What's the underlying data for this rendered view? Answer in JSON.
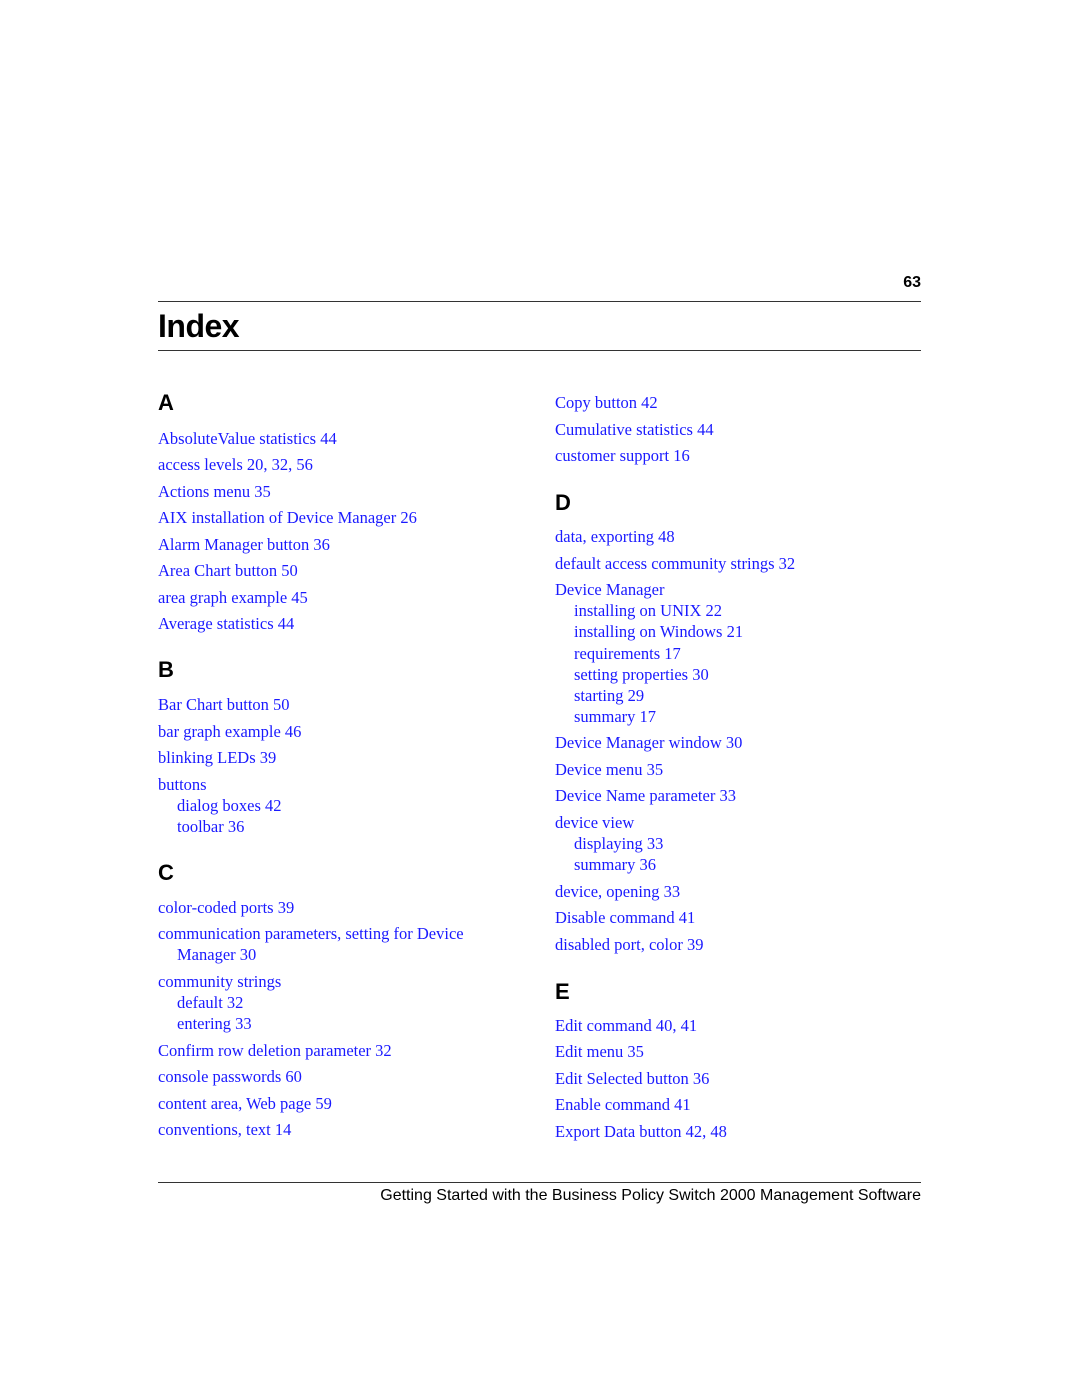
{
  "header": {
    "page_number": "63",
    "title": "Index"
  },
  "footer": {
    "text": "Getting Started with the Business Policy Switch 2000 Management Software"
  },
  "colors": {
    "link": "#1a1aff",
    "text": "#000000"
  },
  "sections": {
    "A": {
      "letter": "A",
      "entries": [
        "AbsoluteValue statistics 44",
        "access levels 20, 32, 56",
        "Actions menu 35",
        "AIX installation of Device Manager 26",
        "Alarm Manager button 36",
        "Area Chart button 50",
        "area graph example 45",
        "Average statistics 44"
      ]
    },
    "B": {
      "letter": "B",
      "entries": [
        "Bar Chart button 50",
        "bar graph example 46",
        "blinking LEDs 39",
        "buttons",
        "dialog boxes 42",
        "toolbar 36"
      ]
    },
    "C": {
      "letter": "C",
      "entries": [
        "color-coded ports 39",
        "communication parameters, setting for Device",
        "Manager 30",
        "community strings",
        "default 32",
        "entering 33",
        "Confirm row deletion parameter 32",
        "console passwords 60",
        "content area, Web page 59",
        "conventions, text 14",
        "Copy button 42",
        "Cumulative statistics 44",
        "customer support 16"
      ]
    },
    "D": {
      "letter": "D",
      "entries": [
        "data, exporting 48",
        "default access community strings 32",
        "Device Manager",
        "installing on UNIX 22",
        "installing on Windows 21",
        "requirements 17",
        "setting properties 30",
        "starting 29",
        "summary 17",
        "Device Manager window 30",
        "Device menu 35",
        "Device Name parameter 33",
        "device view",
        "displaying 33",
        "summary 36",
        "device, opening 33",
        "Disable command 41",
        "disabled port, color 39"
      ]
    },
    "E": {
      "letter": "E",
      "entries": [
        "Edit command 40, 41",
        "Edit menu 35",
        "Edit Selected button 36",
        "Enable command 41",
        "Export Data button 42, 48"
      ]
    }
  }
}
